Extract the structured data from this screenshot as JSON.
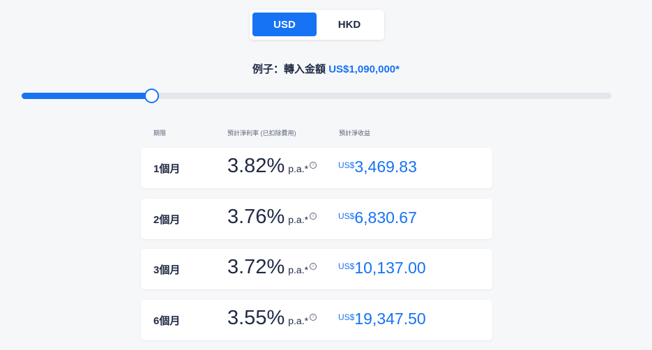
{
  "currency_toggle": {
    "options": [
      "USD",
      "HKD"
    ],
    "selected": "USD"
  },
  "example": {
    "label": "例子：轉入金額",
    "amount": "US$1,090,000*"
  },
  "slider": {
    "fraction": 0.22
  },
  "table_headers": {
    "term": "期限",
    "rate": "預計淨利率 (已扣除費用)",
    "earnings": "預計淨收益"
  },
  "rows": [
    {
      "term": "1個月",
      "rate": "3.82%",
      "pa": "p.a.*",
      "currency": "US$",
      "earnings": "3,469.83"
    },
    {
      "term": "2個月",
      "rate": "3.76%",
      "pa": "p.a.*",
      "currency": "US$",
      "earnings": "6,830.67"
    },
    {
      "term": "3個月",
      "rate": "3.72%",
      "pa": "p.a.*",
      "currency": "US$",
      "earnings": "10,137.00"
    },
    {
      "term": "6個月",
      "rate": "3.55%",
      "pa": "p.a.*",
      "currency": "US$",
      "earnings": "19,347.50"
    }
  ],
  "colors": {
    "accent": "#1673f4",
    "text": "#1f2a44",
    "background": "#f6f7f9"
  },
  "icons": {
    "info": "info-circle-icon"
  }
}
